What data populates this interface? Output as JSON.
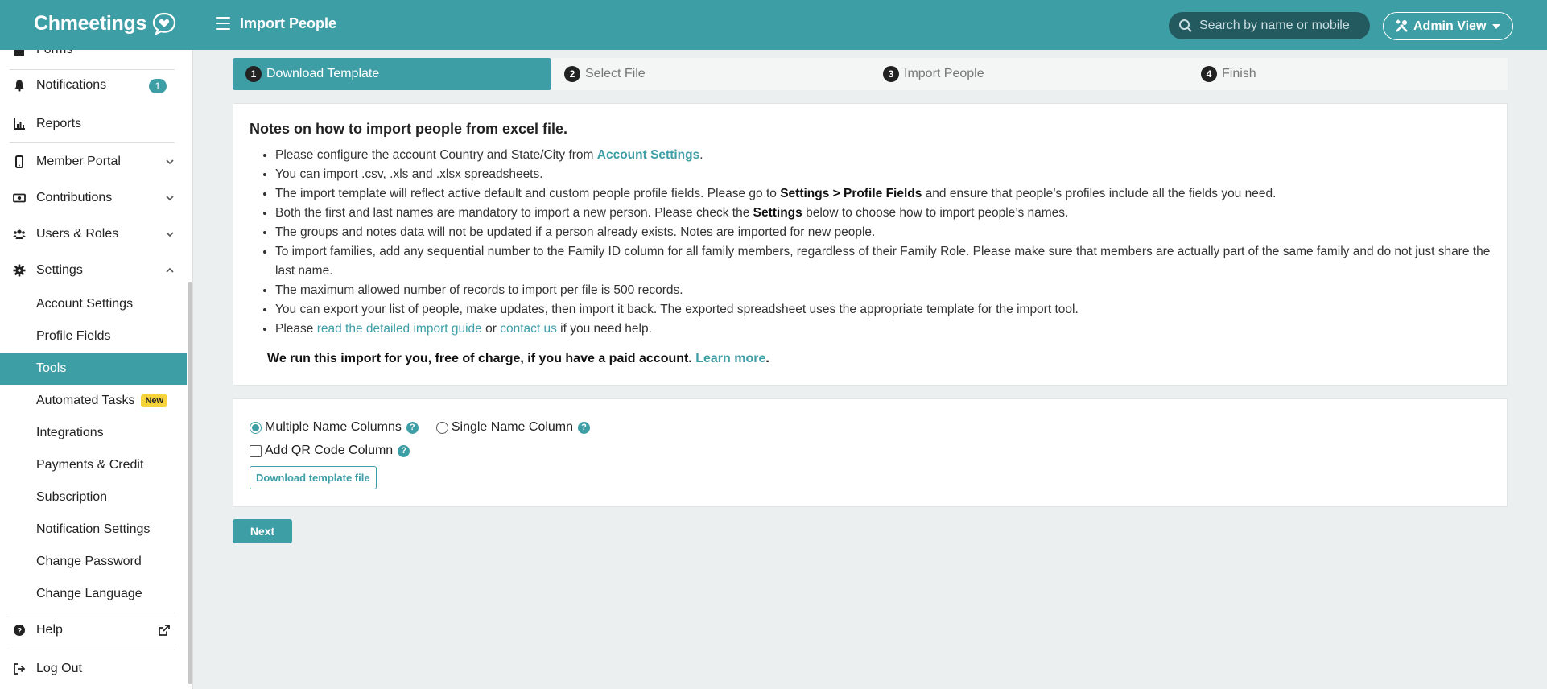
{
  "app": {
    "brand": "Chmeetings",
    "page_title": "Import People"
  },
  "header": {
    "search_placeholder": "Search by name or mobile",
    "admin_view": "Admin View"
  },
  "sidebar": {
    "partial_top": "Forms",
    "notifications": {
      "label": "Notifications",
      "badge": "1"
    },
    "reports": "Reports",
    "member_portal": "Member Portal",
    "contributions": "Contributions",
    "users_roles": "Users & Roles",
    "settings": "Settings",
    "sub": {
      "account_settings": "Account Settings",
      "profile_fields": "Profile Fields",
      "tools": "Tools",
      "automated_tasks": "Automated Tasks",
      "new_badge": "New",
      "integrations": "Integrations",
      "payments_credit": "Payments & Credit",
      "subscription": "Subscription",
      "notification_settings": "Notification Settings",
      "change_password": "Change Password",
      "change_language": "Change Language"
    },
    "help": "Help",
    "logout": "Log Out"
  },
  "steps": [
    {
      "num": "1",
      "label": "Download Template"
    },
    {
      "num": "2",
      "label": "Select File"
    },
    {
      "num": "3",
      "label": "Import People"
    },
    {
      "num": "4",
      "label": "Finish"
    }
  ],
  "notes": {
    "title": "Notes on how to import people from excel file.",
    "l1_pre": "Please configure the account Country and State/City from ",
    "l1_link": "Account Settings",
    "l1_post": ".",
    "l2": "You can import .csv, .xls and .xlsx spreadsheets.",
    "l3_pre": "The import template will reflect active default and custom people profile fields. Please go to ",
    "l3_bold": "Settings > Profile Fields",
    "l3_post": " and ensure that people’s profiles include all the fields you need.",
    "l4_pre": "Both the first and last names are mandatory to import a new person. Please check the ",
    "l4_bold": "Settings",
    "l4_post": " below to choose how to import people’s names.",
    "l5": "The groups and notes data will not be updated if a person already exists. Notes are imported for new people.",
    "l6": "To import families, add any sequential number to the Family ID column for all family members, regardless of their Family Role. Please make sure that members are actually part of the same family and do not just share the last name.",
    "l7": "The maximum allowed number of records to import per file is 500 records.",
    "l8": "You can export your list of people, make updates, then import it back. The exported spreadsheet uses the appropriate template for the import tool.",
    "l9_pre": "Please ",
    "l9_link1": "read the detailed import guide",
    "l9_mid": " or ",
    "l9_link2": "contact us",
    "l9_post": " if you need help.",
    "paid_pre": "We run this import for you, free of charge, if you have a paid account. ",
    "paid_link": "Learn more",
    "paid_post": "."
  },
  "options": {
    "multiple_name": "Multiple Name Columns",
    "single_name": "Single Name Column",
    "qr_code": "Add QR Code Column",
    "help_glyph": "?",
    "download_btn": "Download template file"
  },
  "next_btn": "Next",
  "colors": {
    "accent": "#3e9ea6",
    "search_bg": "#235a60",
    "new_badge": "#f7d33b"
  }
}
